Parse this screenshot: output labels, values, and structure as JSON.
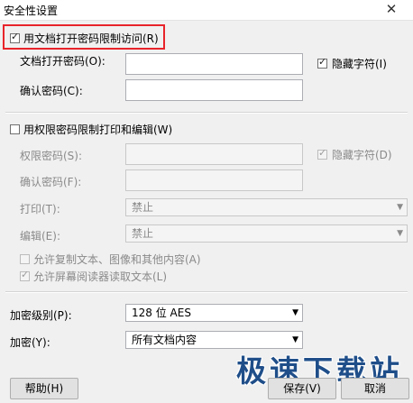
{
  "window": {
    "title": "安全性设置",
    "close": "✕"
  },
  "open_password": {
    "checkbox_label": "用文档打开密码限制访问(R)",
    "checked": true,
    "password_label": "文档打开密码(O):",
    "confirm_label": "确认密码(C):",
    "hide_chars_label": "隐藏字符(I)",
    "hide_chars_checked": true
  },
  "permission_password": {
    "checkbox_label": "用权限密码限制打印和编辑(W)",
    "checked": false,
    "password_label": "权限密码(S):",
    "confirm_label": "确认密码(F):",
    "hide_chars_label": "隐藏字符(D)",
    "hide_chars_checked": true,
    "print_label": "打印(T):",
    "print_value": "禁止",
    "edit_label": "编辑(E):",
    "edit_value": "禁止",
    "allow_copy_label": "允许复制文本、图像和其他内容(A)",
    "allow_copy_checked": false,
    "allow_reader_label": "允许屏幕阅读器读取文本(L)",
    "allow_reader_checked": true
  },
  "encryption": {
    "level_label": "加密级别(P):",
    "level_value": "128 位 AES",
    "scope_label": "加密(Y):",
    "scope_value": "所有文档内容"
  },
  "buttons": {
    "help": "帮助(H)",
    "save": "保存(V)",
    "cancel": "取消"
  },
  "watermark": "极速下载站"
}
